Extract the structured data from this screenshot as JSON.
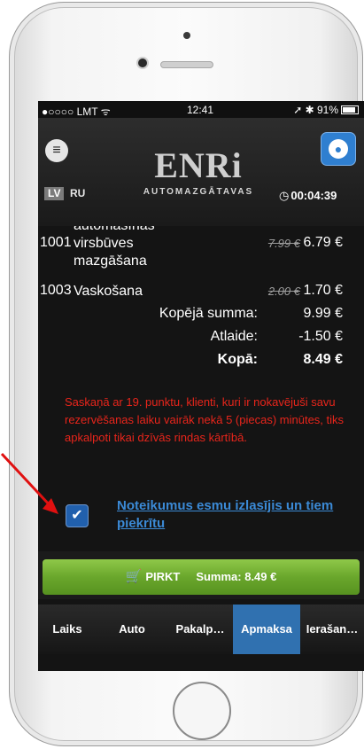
{
  "status_bar": {
    "carrier": "●○○○○ LMT ᯤ",
    "time": "12:41",
    "battery": "➚ ✱ 91%"
  },
  "header": {
    "menu_icon": "hamburger-icon",
    "user_icon": "user-icon",
    "logo_text": "ENRi",
    "logo_subtitle": "AUTOMAZGĀTAVAS",
    "languages": [
      "LV",
      "RU"
    ],
    "active_language": "LV",
    "timer_icon": "◷",
    "timer": "00:04:39"
  },
  "order": {
    "items": [
      {
        "code": "1001",
        "desc_lines": [
          "automašīnas",
          "virsbūves",
          "mazgāšana"
        ],
        "old_price": "7.99 €",
        "price": "6.79 €"
      },
      {
        "code": "1003",
        "desc_lines": [
          "Vaskošana"
        ],
        "old_price": "2.00 €",
        "price": "1.70 €"
      }
    ],
    "subtotal_label": "Kopējā summa:",
    "subtotal": "9.99 €",
    "discount_label": "Atlaide:",
    "discount": "-1.50 €",
    "total_label": "Kopā:",
    "total": "8.49 €"
  },
  "warning": "Saskaņā ar 19. punktu, klienti, kuri ir nokavējuši savu rezervēšanas laiku vairāk nekā 5 (piecas) minūtes, tiks apkalpoti tikai dzīvās rindas kārtībā.",
  "terms": {
    "checked": true,
    "checkmark": "✔",
    "label": "Noteikumus esmu izlasījis un tiem piekrītu"
  },
  "buy_button": {
    "icon": "🛒",
    "label": "PIRKT",
    "sum": "Summa: 8.49 €"
  },
  "tabs": [
    {
      "label": "Laiks"
    },
    {
      "label": "Auto"
    },
    {
      "label": "Pakalp…"
    },
    {
      "label": "Apmaksa",
      "active": true
    },
    {
      "label": "Ierašan…"
    }
  ],
  "colors": {
    "warning": "#e8251b",
    "terms_link": "#3b8ad6",
    "buy_button": "#6aa72c",
    "active_tab": "#3071b0",
    "annotation_arrow": "#e01010"
  }
}
